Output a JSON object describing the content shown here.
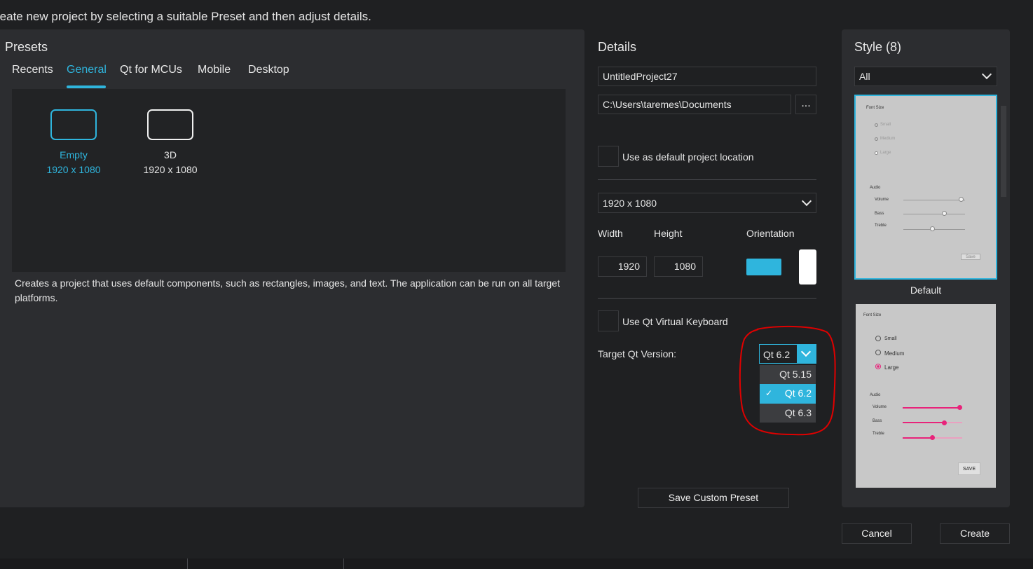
{
  "headline": "reate new project by selecting a suitable Preset and then adjust details.",
  "presets": {
    "title": "Presets",
    "tabs": [
      "Recents",
      "General",
      "Qt for MCUs",
      "Mobile",
      "Desktop"
    ],
    "active_tab": "General",
    "items": [
      {
        "name": "Empty",
        "size": "1920 x 1080",
        "selected": true
      },
      {
        "name": "3D",
        "size": "1920 x 1080",
        "selected": false
      }
    ],
    "description_line1": "Creates a project that uses default components, such as rectangles, images, and text. The application can be run on all target",
    "description_line2": "platforms."
  },
  "details": {
    "title": "Details",
    "project_name": "UntitledProject27",
    "location": "C:\\Users\\taremes\\Documents",
    "browse_label": "...",
    "default_location_label": "Use as default project location",
    "resolution": "1920 x 1080",
    "width_label": "Width",
    "height_label": "Height",
    "orientation_label": "Orientation",
    "width_value": "1920",
    "height_value": "1080",
    "virtual_keyboard_label": "Use Qt Virtual Keyboard",
    "target_qt_label": "Target Qt Version:",
    "target_qt_value": "Qt 6.2",
    "qt_options": [
      "Qt 5.15",
      "Qt 6.2",
      "Qt 6.3"
    ],
    "qt_selected_index": 1,
    "save_preset_label": "Save Custom Preset"
  },
  "style": {
    "title": "Style (8)",
    "filter": "All",
    "items": [
      {
        "name": "Default",
        "selected": true,
        "preview": {
          "font_size": "Font Size",
          "options": [
            "Small",
            "Medium",
            "Large"
          ],
          "audio": "Audio",
          "sliders": [
            "Volume",
            "Bass",
            "Treble"
          ],
          "save": "Save"
        }
      },
      {
        "name": "",
        "selected": false,
        "preview": {
          "font_size": "Font Size",
          "options": [
            "Small",
            "Medium",
            "Large"
          ],
          "audio": "Audio",
          "sliders": [
            "Volume",
            "Bass",
            "Treble"
          ],
          "save": "SAVE"
        }
      }
    ]
  },
  "footer": {
    "cancel_label": "Cancel",
    "create_label": "Create"
  },
  "colors": {
    "accent": "#2fb5dd",
    "panel": "#2c2d30",
    "background": "#1f2022",
    "annotation": "#e00000",
    "material_accent": "#e8237a"
  },
  "annotation": {
    "shape": "red hand-drawn circle around Target Qt Version dropdown"
  }
}
